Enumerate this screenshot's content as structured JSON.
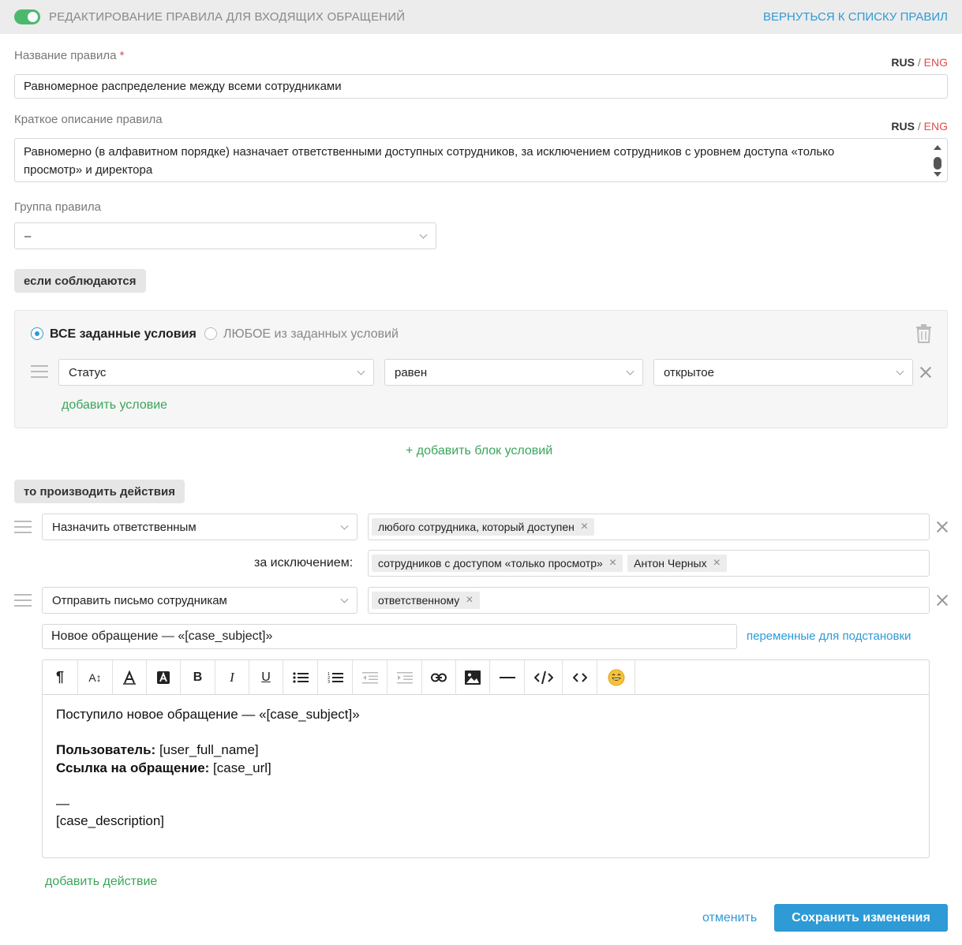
{
  "header": {
    "title": "РЕДАКТИРОВАНИЕ ПРАВИЛА ДЛЯ ВХОДЯЩИХ ОБРАЩЕНИЙ",
    "back_link": "ВЕРНУТЬСЯ К СПИСКУ ПРАВИЛ",
    "enabled": true
  },
  "lang": {
    "rus": "RUS",
    "sep": "/",
    "eng": "ENG"
  },
  "name_field": {
    "label": "Название правила",
    "required_mark": "*",
    "value": "Равномерное распределение между всеми сотрудниками"
  },
  "description_field": {
    "label": "Краткое описание правила",
    "line1": "Равномерно (в алфавитном порядке) назначает ответственными доступных сотрудников, за исключением сотрудников с уровнем доступа «только",
    "line2": "просмотр» и директора"
  },
  "group_field": {
    "label": "Группа правила",
    "value": "–"
  },
  "conditions": {
    "header": "если соблюдаются",
    "mode_all": "ВСЕ заданные условия",
    "mode_any": "ЛЮБОЕ из заданных условий",
    "selected_mode": "all",
    "row": {
      "field": "Статус",
      "operator": "равен",
      "value": "открытое"
    },
    "add_condition": "добавить условие",
    "add_block": "+ добавить блок условий"
  },
  "actions": {
    "header": "то производить действия",
    "action1": {
      "type": "Назначить ответственным",
      "tag": "любого сотрудника, который доступен",
      "except_label": "за исключением:",
      "except_tags": [
        "сотрудников с доступом «только просмотр»",
        "Антон Черных"
      ]
    },
    "action2": {
      "type": "Отправить письмо сотрудникам",
      "tag": "ответственному",
      "subject": "Новое обращение — «[case_subject]»",
      "variables_link": "переменные для подстановки"
    },
    "add_action": "добавить действие"
  },
  "toolbar": {
    "paragraph": "¶",
    "font_size": "A↕",
    "bold": "B",
    "italic": "I",
    "underline": "U"
  },
  "editor": {
    "line1": "Поступило новое обращение — «[case_subject]»",
    "user_label": "Пользователь:",
    "user_value": " [user_full_name]",
    "link_label": "Ссылка на обращение:",
    "link_value": " [case_url]",
    "dash": "—",
    "description": "[case_description]"
  },
  "footer": {
    "cancel": "отменить",
    "save": "Сохранить изменения"
  },
  "colors": {
    "accent": "#2e9ad6",
    "green": "#3aa65a",
    "red": "#e04c4c",
    "toggle": "#4cb86b"
  }
}
